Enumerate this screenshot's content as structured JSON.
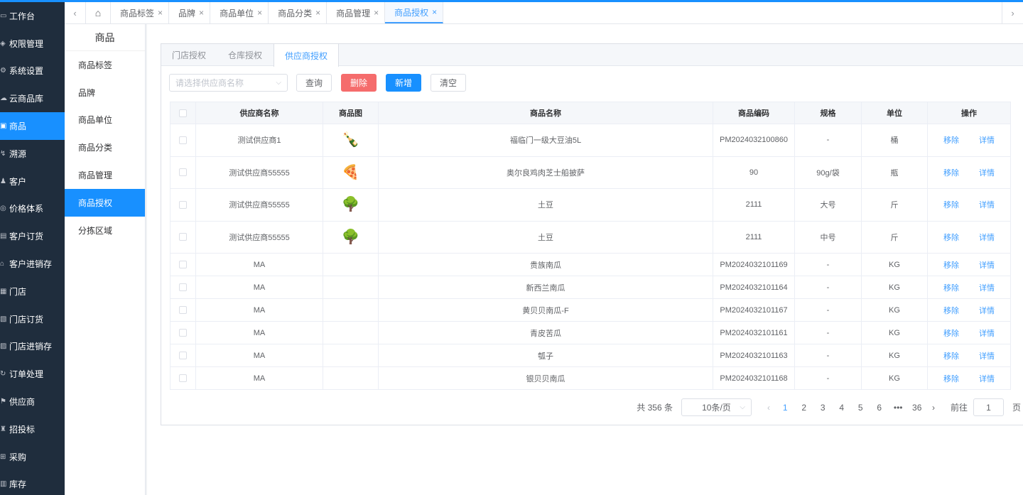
{
  "colors": {
    "accent": "#1890ff",
    "danger": "#f56c6c",
    "sidebar_bg": "#1f2d3d"
  },
  "sidebar": {
    "items": [
      {
        "label": "工作台",
        "icon": "monitor-icon"
      },
      {
        "label": "权限管理",
        "icon": "shield-icon"
      },
      {
        "label": "系统设置",
        "icon": "gear-icon"
      },
      {
        "label": "云商品库",
        "icon": "cloud-icon"
      },
      {
        "label": "商品",
        "icon": "box-icon",
        "active": true
      },
      {
        "label": "溯源",
        "icon": "trace-icon"
      },
      {
        "label": "客户",
        "icon": "user-icon"
      },
      {
        "label": "价格体系",
        "icon": "price-icon"
      },
      {
        "label": "客户订货",
        "icon": "order-icon"
      },
      {
        "label": "客户进销存",
        "icon": "warehouse-icon"
      },
      {
        "label": "门店",
        "icon": "store-icon"
      },
      {
        "label": "门店订货",
        "icon": "store-order-icon"
      },
      {
        "label": "门店进销存",
        "icon": "store-stock-icon"
      },
      {
        "label": "订单处理",
        "icon": "process-icon"
      },
      {
        "label": "供应商",
        "icon": "supplier-icon"
      },
      {
        "label": "招投标",
        "icon": "bid-icon"
      },
      {
        "label": "采购",
        "icon": "purchase-icon"
      },
      {
        "label": "库存",
        "icon": "stock-icon"
      }
    ]
  },
  "tabbar": {
    "tabs": [
      {
        "label": "商品标签"
      },
      {
        "label": "品牌"
      },
      {
        "label": "商品单位"
      },
      {
        "label": "商品分类"
      },
      {
        "label": "商品管理"
      },
      {
        "label": "商品授权",
        "active": true
      }
    ],
    "close_glyph": "×"
  },
  "submenu": {
    "title": "商品",
    "items": [
      {
        "label": "商品标签"
      },
      {
        "label": "品牌"
      },
      {
        "label": "商品单位"
      },
      {
        "label": "商品分类"
      },
      {
        "label": "商品管理"
      },
      {
        "label": "商品授权",
        "active": true
      },
      {
        "label": "分拣区域"
      }
    ]
  },
  "card": {
    "tabs": [
      {
        "label": "门店授权"
      },
      {
        "label": "仓库授权"
      },
      {
        "label": "供应商授权",
        "active": true
      }
    ]
  },
  "toolbar": {
    "select_placeholder": "请选择供应商名称",
    "query": "查询",
    "delete": "删除",
    "add": "新增",
    "clear": "清空"
  },
  "table": {
    "headers": {
      "supplier": "供应商名称",
      "image": "商品图",
      "name": "商品名称",
      "code": "商品编码",
      "spec": "规格",
      "unit": "单位",
      "ops": "操作"
    },
    "op_remove": "移除",
    "op_detail": "详情",
    "rows": [
      {
        "supplier": "测试供应商1",
        "img": "🍾",
        "name": "福临门一级大豆油5L",
        "code": "PM2024032100860",
        "spec": "-",
        "unit": "桶",
        "tall": true
      },
      {
        "supplier": "测试供应商55555",
        "img": "🍕",
        "name": "奥尔良鸡肉芝士船披萨",
        "code": "90",
        "spec": "90g/袋",
        "unit": "瓶",
        "tall": true
      },
      {
        "supplier": "测试供应商55555",
        "img": "🌳",
        "name": "土豆",
        "code": "2111",
        "spec": "大号",
        "unit": "斤",
        "tall": true
      },
      {
        "supplier": "测试供应商55555",
        "img": "🌳",
        "name": "土豆",
        "code": "2111",
        "spec": "中号",
        "unit": "斤",
        "tall": true
      },
      {
        "supplier": "MA",
        "img": "",
        "name": "贵族南瓜",
        "code": "PM2024032101169",
        "spec": "-",
        "unit": "KG",
        "tall": false
      },
      {
        "supplier": "MA",
        "img": "",
        "name": "新西兰南瓜",
        "code": "PM2024032101164",
        "spec": "-",
        "unit": "KG",
        "tall": false
      },
      {
        "supplier": "MA",
        "img": "",
        "name": "黄贝贝南瓜-F",
        "code": "PM2024032101167",
        "spec": "-",
        "unit": "KG",
        "tall": false
      },
      {
        "supplier": "MA",
        "img": "",
        "name": "青皮苦瓜",
        "code": "PM2024032101161",
        "spec": "-",
        "unit": "KG",
        "tall": false
      },
      {
        "supplier": "MA",
        "img": "",
        "name": "瓠子",
        "code": "PM2024032101163",
        "spec": "-",
        "unit": "KG",
        "tall": false
      },
      {
        "supplier": "MA",
        "img": "",
        "name": "银贝贝南瓜",
        "code": "PM2024032101168",
        "spec": "-",
        "unit": "KG",
        "tall": false
      }
    ]
  },
  "pagination": {
    "total": "共 356 条",
    "page_size": "10条/页",
    "pages": [
      "1",
      "2",
      "3",
      "4",
      "5",
      "6",
      "•••",
      "36"
    ],
    "current": "1",
    "goto_label": "前往",
    "goto_value": "1",
    "page_suffix": "页"
  }
}
